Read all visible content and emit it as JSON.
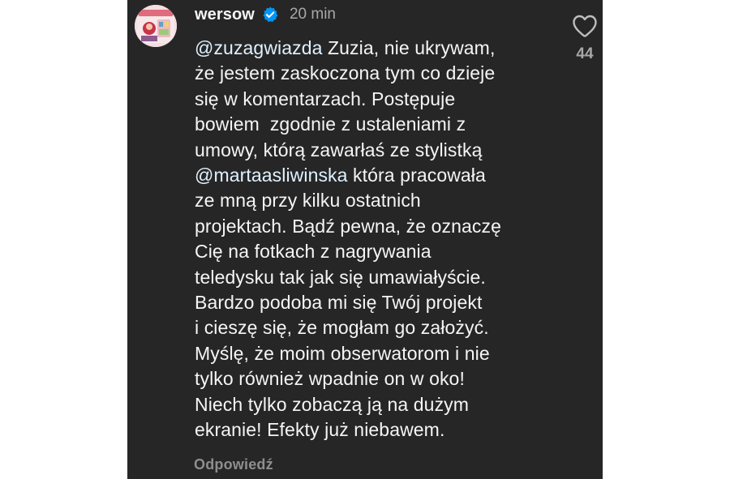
{
  "comment": {
    "username": "wersow",
    "time": "20 min",
    "lines": [
      {
        "mention": "@zuzagwiazda",
        "text": " Zuzia, nie ukrywam,"
      },
      {
        "text": "że jestem zaskoczona tym co dzieje"
      },
      {
        "text": "się w komentarzach. Postępuje"
      },
      {
        "text": "bowiem  zgodnie z ustaleniami z"
      },
      {
        "text": "umowy, którą zawarłaś ze stylistką"
      },
      {
        "mention": "@martaasliwinska",
        "text": " która pracowała"
      },
      {
        "text": "ze mną przy kilku ostatnich"
      },
      {
        "text": "projektach. Bądź pewna, że oznaczę"
      },
      {
        "text": "Cię na fotkach z nagrywania"
      },
      {
        "text": "teledysku tak jak się umawiałyście."
      },
      {
        "text": "Bardzo podoba mi się Twój projekt"
      },
      {
        "text": "i cieszę się, że mogłam go założyć."
      },
      {
        "text": "Myślę, że moim obserwatorom i nie"
      },
      {
        "text": "tylko również wpadnie on w oko!"
      },
      {
        "text": "Niech tylko zobaczą ją na dużym"
      },
      {
        "text": "ekranie! Efekty już niebawem."
      }
    ],
    "reply_label": "Odpowiedź",
    "like_count": "44"
  },
  "icons": {
    "verified": "verified-badge-icon",
    "like": "heart-outline-icon"
  },
  "colors": {
    "background": "#262626",
    "text": "#f5f5f5",
    "muted": "#a8a8a8",
    "mention": "#e0f1ff",
    "verified": "#0095f6"
  }
}
